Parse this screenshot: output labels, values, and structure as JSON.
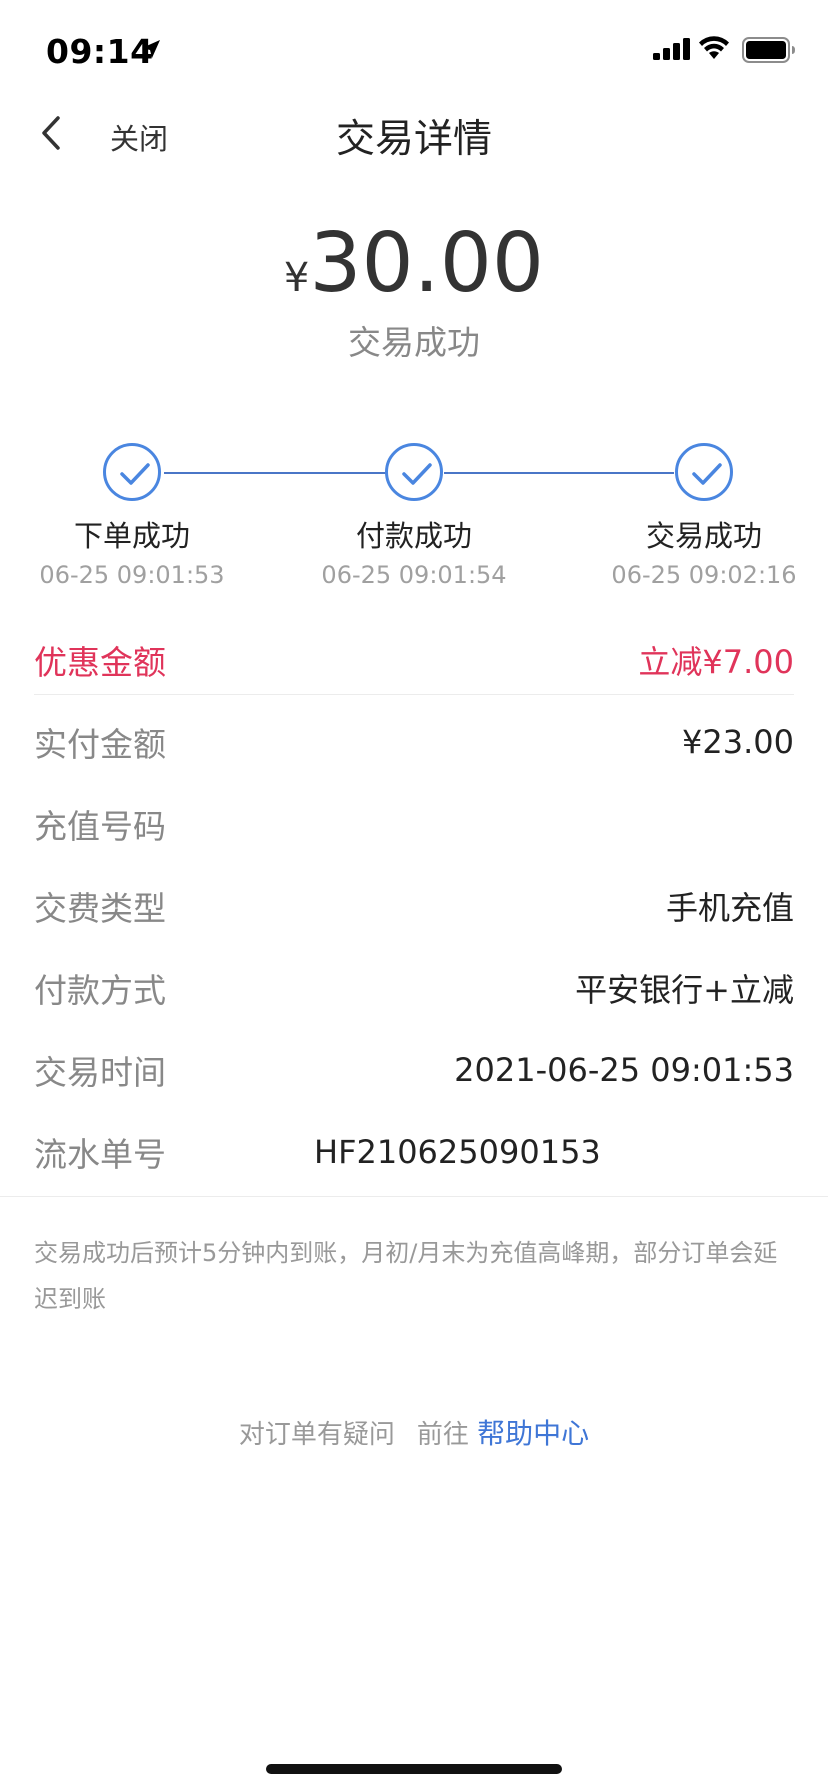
{
  "status_bar": {
    "time": "09:14",
    "icons": [
      "location-arrow-icon",
      "signal-icon",
      "wifi-icon",
      "battery-icon"
    ]
  },
  "nav": {
    "back_icon": "chevron-left-icon",
    "close_label": "关闭",
    "title": "交易详情"
  },
  "summary": {
    "currency": "¥",
    "amount": "30.00",
    "status": "交易成功"
  },
  "progress": {
    "steps": [
      {
        "label": "下单成功",
        "time": "06-25 09:01:53",
        "icon": "check-circle-icon"
      },
      {
        "label": "付款成功",
        "time": "06-25 09:01:54",
        "icon": "check-circle-icon"
      },
      {
        "label": "交易成功",
        "time": "06-25 09:02:16",
        "icon": "check-circle-icon"
      }
    ]
  },
  "details": {
    "discount": {
      "label": "优惠金额",
      "value": "立减¥7.00"
    },
    "paid": {
      "label": "实付金额",
      "value": "¥23.00"
    },
    "recharge_number": {
      "label": "充值号码",
      "value": ""
    },
    "fee_type": {
      "label": "交费类型",
      "value": "手机充值"
    },
    "payment_method": {
      "label": "付款方式",
      "value": "平安银行+立减"
    },
    "trade_time": {
      "label": "交易时间",
      "value": "2021-06-25 09:01:53"
    },
    "serial_no": {
      "label": "流水单号",
      "value": "HF210625090153"
    }
  },
  "notice": "交易成功后预计5分钟内到账，月初/月末为充值高峰期，部分订单会延迟到账",
  "help": {
    "question": "对订单有疑问",
    "goto": "前往",
    "link": "帮助中心"
  },
  "colors": {
    "accent_blue": "#4a86e0",
    "discount_red": "#e0345a",
    "link_blue": "#3f76d6"
  }
}
